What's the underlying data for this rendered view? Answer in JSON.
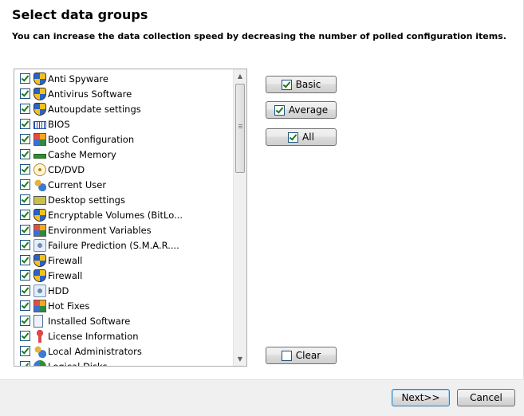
{
  "header": {
    "title": "Select data groups",
    "subtitle": "You can increase the data collection speed by decreasing the number of polled configuration items."
  },
  "items": [
    {
      "label": "Anti Spyware",
      "icon": "shield-icon",
      "checked": true
    },
    {
      "label": "Antivirus Software",
      "icon": "shield-icon",
      "checked": true
    },
    {
      "label": "Autoupdate settings",
      "icon": "shield-icon",
      "checked": true
    },
    {
      "label": "BIOS",
      "icon": "chip-icon",
      "checked": true
    },
    {
      "label": "Boot Configuration",
      "icon": "windows-icon",
      "checked": true
    },
    {
      "label": "Cashe Memory",
      "icon": "memory-icon",
      "checked": true
    },
    {
      "label": "CD/DVD",
      "icon": "disc-icon",
      "checked": true
    },
    {
      "label": "Current User",
      "icon": "users-icon",
      "checked": true
    },
    {
      "label": "Desktop settings",
      "icon": "desktop-icon",
      "checked": true
    },
    {
      "label": "Encryptable Volumes (BitLo...",
      "icon": "shield-icon",
      "checked": true
    },
    {
      "label": "Environment Variables",
      "icon": "windows-icon",
      "checked": true
    },
    {
      "label": "Failure Prediction (S.M.A.R....",
      "icon": "hdd-icon",
      "checked": true
    },
    {
      "label": "Firewall",
      "icon": "shield-icon",
      "checked": true
    },
    {
      "label": "Firewall",
      "icon": "shield-icon",
      "checked": true
    },
    {
      "label": "HDD",
      "icon": "hdd-icon",
      "checked": true
    },
    {
      "label": "Hot Fixes",
      "icon": "windows-icon",
      "checked": true
    },
    {
      "label": "Installed Software",
      "icon": "document-icon",
      "checked": true
    },
    {
      "label": "License Information",
      "icon": "key-icon",
      "checked": true
    },
    {
      "label": "Local Administrators",
      "icon": "users-icon",
      "checked": true
    },
    {
      "label": "Logical Disks",
      "icon": "pie-icon",
      "checked": true
    }
  ],
  "buttons": {
    "basic": "Basic",
    "average": "Average",
    "all": "All",
    "clear": "Clear",
    "next": "Next>>",
    "cancel": "Cancel"
  }
}
